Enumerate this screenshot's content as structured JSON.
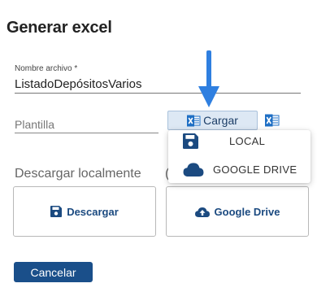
{
  "dialog": {
    "title": "Generar excel"
  },
  "nombre_archivo": {
    "label": "Nombre archivo *",
    "value": "ListadoDepósitosVarios"
  },
  "plantilla": {
    "label": "Plantilla"
  },
  "cargar": {
    "label": "Cargar"
  },
  "cargar_menu": {
    "items": [
      {
        "label": "LOCAL"
      },
      {
        "label": "GOOGLE DRIVE"
      }
    ]
  },
  "descargar": {
    "section_label": "Descargar localmente",
    "cut_label": "(",
    "descargar_label": "Descargar",
    "drive_label": "Google Drive"
  },
  "actions": {
    "cancel_label": "Cancelar"
  },
  "colors": {
    "accent": "#1a4f8a",
    "arrow": "#2f7fe0",
    "excel": "#1f6fc4"
  }
}
